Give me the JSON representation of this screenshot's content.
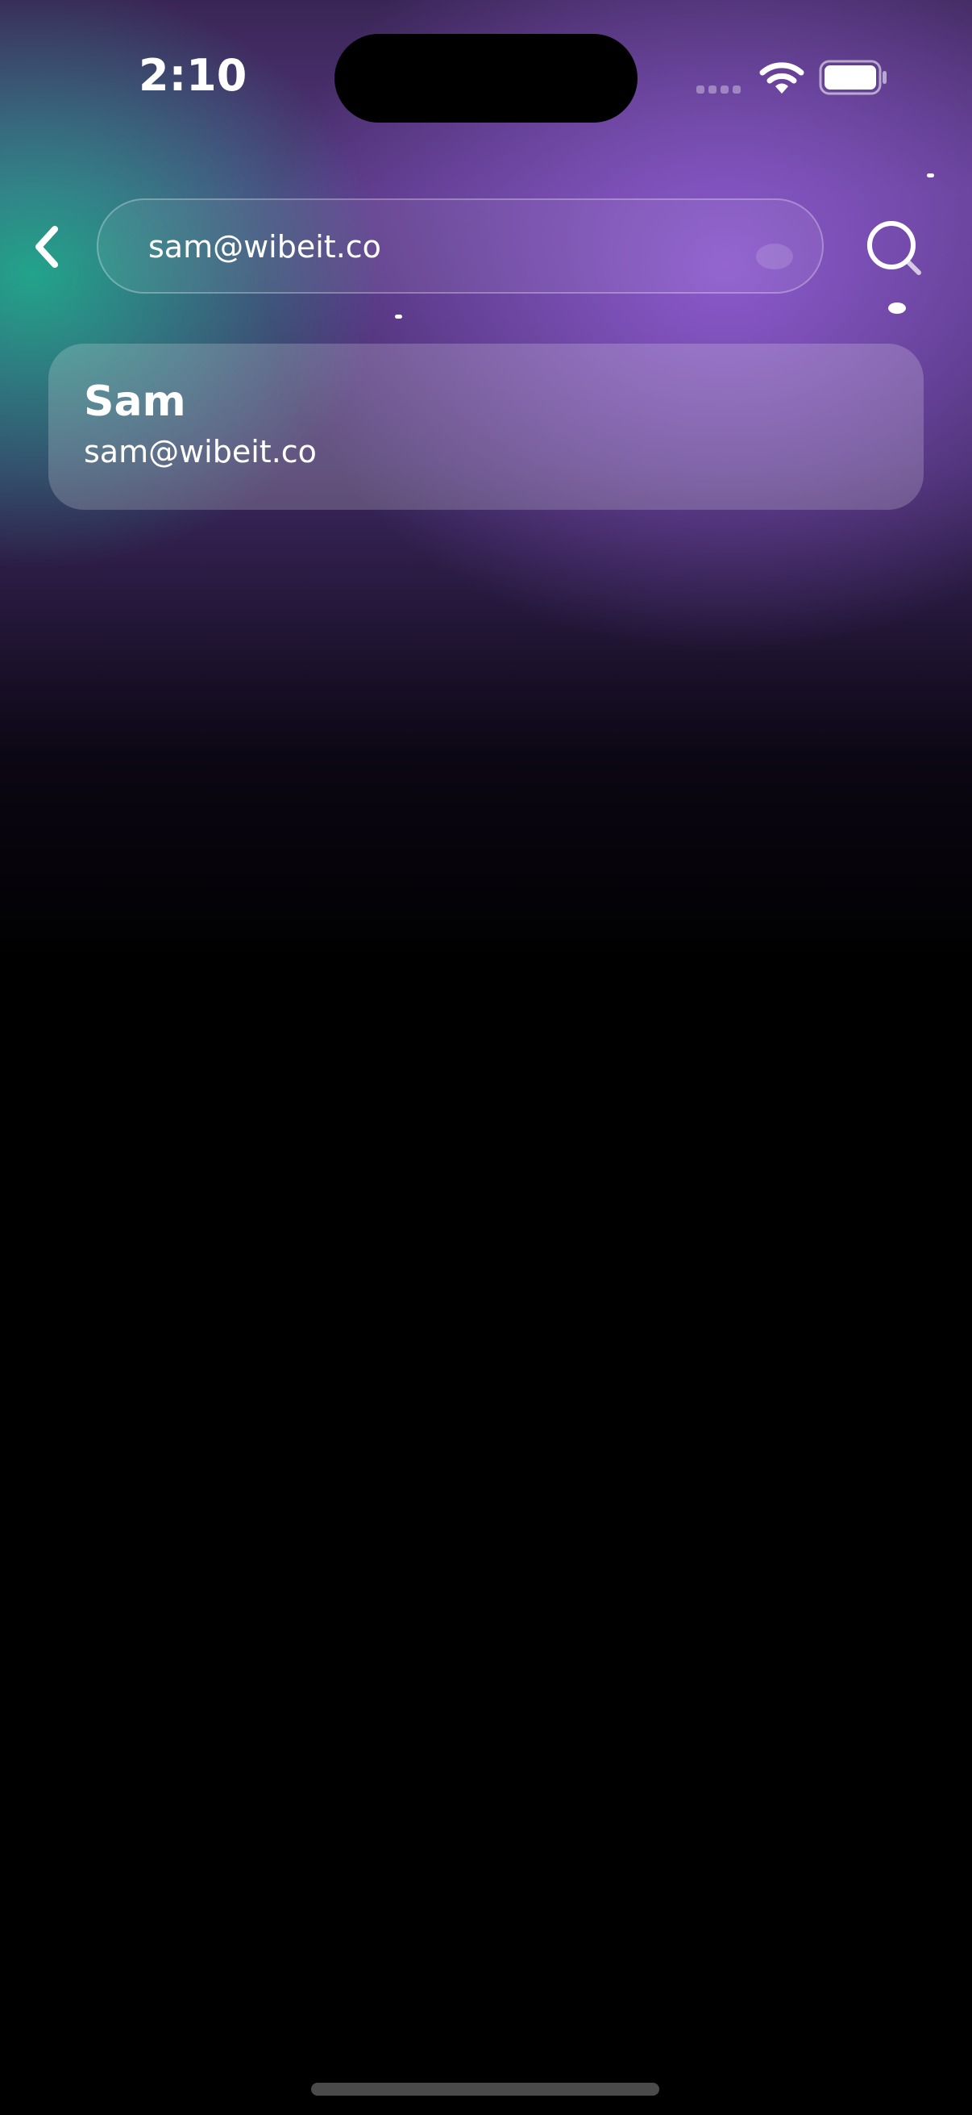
{
  "status_bar": {
    "time": "2:10"
  },
  "icons": {
    "back": "chevron-left-icon",
    "search": "search-icon",
    "wifi": "wifi-icon",
    "battery": "battery-icon"
  },
  "search": {
    "value": "sam@wibeit.co"
  },
  "results": [
    {
      "name": "Sam",
      "email": "sam@wibeit.co"
    }
  ],
  "colors": {
    "accent_purple": "#7b4fb8",
    "accent_green": "#20aa8c",
    "background": "#000000"
  }
}
